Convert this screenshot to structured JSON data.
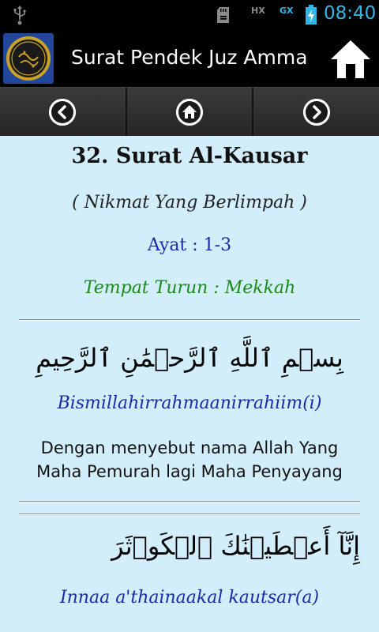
{
  "status_bar": {
    "time": "08:40",
    "icons": [
      "usb-icon",
      "sd-card-icon",
      "hx-icon",
      "gx-icon",
      "battery-charging-icon"
    ],
    "hx_label": "HX",
    "gx_label": "GX",
    "accent_color": "#33b5e5"
  },
  "app_bar": {
    "title": "Surat Pendek Juz Amma",
    "logo_icon": "quran-logo-icon",
    "home_icon": "home-icon"
  },
  "nav_bar": {
    "items": [
      {
        "icon": "chevron-left-icon"
      },
      {
        "icon": "home-icon"
      },
      {
        "icon": "chevron-right-icon"
      }
    ]
  },
  "surah": {
    "title": "32. Surat Al-Kausar",
    "meaning": "( Nikmat Yang Berlimpah )",
    "ayat_range": "Ayat : 1-3",
    "place": "Tempat Turun : Mekkah"
  },
  "verses": [
    {
      "arabic": "بِسۡمِ ٱللَّهِ ٱلرَّحۡمَٰنِ ٱلرَّحِيمِ",
      "transliteration": "Bismillahirrahmaanirrahiim(i)",
      "translation_line1": "Dengan menyebut nama Allah Yang",
      "translation_line2": "Maha Pemurah lagi Maha Penyayang"
    },
    {
      "arabic": "إِنَّآ أَعۡطَيۡنَٰكَ ٱلۡكَوۡثَرَ",
      "transliteration": "Innaa a'thainaakal kautsar(a)"
    }
  ],
  "colors": {
    "content_background": "#d2eefb",
    "transliteration": "#1a2aa8",
    "place": "#1b8a1b"
  }
}
